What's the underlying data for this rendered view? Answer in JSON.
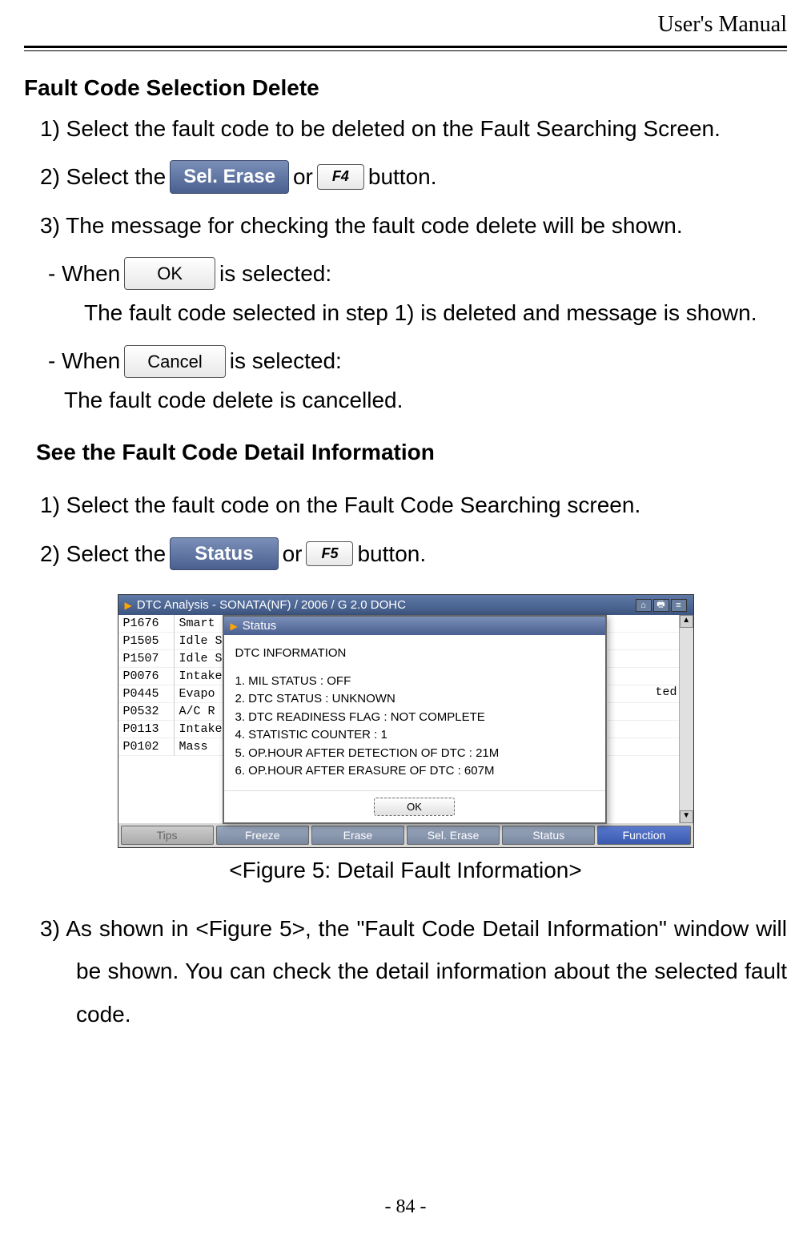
{
  "header": "User's Manual",
  "page_number": "- 84 -",
  "section1": {
    "title": "Fault Code Selection Delete",
    "step1": "1)  Select the fault code to be deleted on the Fault Searching Screen.",
    "step2_a": "2)  Select the ",
    "step2_btn1": "Sel. Erase",
    "step2_b": " or ",
    "step2_btn2": "F4",
    "step2_c": " button.",
    "step3": "3)  The message for checking the fault code delete will be shown.",
    "when1_a": "- When ",
    "when1_btn": "OK",
    "when1_b": " is selected:",
    "when1_result": "The fault code selected in step 1) is deleted and message is shown.",
    "when2_a": "- When ",
    "when2_btn": "Cancel",
    "when2_b": " is selected:",
    "when2_result": "The fault code delete is cancelled."
  },
  "section2": {
    "title": "See the Fault Code Detail Information",
    "step1": "1) Select the fault code on the Fault Code Searching screen.",
    "step2_a": "2) Select the ",
    "step2_btn1": "Status",
    "step2_b": " or ",
    "step2_btn2": "F5",
    "step2_c": " button.",
    "step3": "3) As shown in <Figure 5>, the \"Fault Code Detail Information\" window will be shown. You can check the detail information about the selected fault code."
  },
  "figure": {
    "caption": "<Figure 5: Detail Fault Information>",
    "window_title": "DTC Analysis - SONATA(NF) / 2006 / G 2.0 DOHC",
    "dtc_rows": [
      {
        "code": "P1676",
        "desc": "Smart"
      },
      {
        "code": "P1505",
        "desc": "Idle S"
      },
      {
        "code": "P1507",
        "desc": "Idle S"
      },
      {
        "code": "P0076",
        "desc": "Intake"
      },
      {
        "code": "P0445",
        "desc": "Evapo"
      },
      {
        "code": "P0532",
        "desc": "A/C R"
      },
      {
        "code": "P0113",
        "desc": "Intake"
      },
      {
        "code": "P0102",
        "desc": "Mass"
      }
    ],
    "right_fragment": "ted",
    "popup": {
      "title": "Status",
      "heading": "DTC INFORMATION",
      "lines": [
        "1. MIL STATUS : OFF",
        "2. DTC STATUS : UNKNOWN",
        "3. DTC READINESS FLAG : NOT COMPLETE",
        "4. STATISTIC COUNTER : 1",
        "5. OP.HOUR AFTER DETECTION OF DTC : 21M",
        "6. OP.HOUR AFTER ERASURE OF DTC : 607M"
      ],
      "ok": "OK"
    },
    "bottom_buttons": [
      "Tips",
      "Freeze",
      "Erase",
      "Sel. Erase",
      "Status",
      "Function"
    ]
  }
}
